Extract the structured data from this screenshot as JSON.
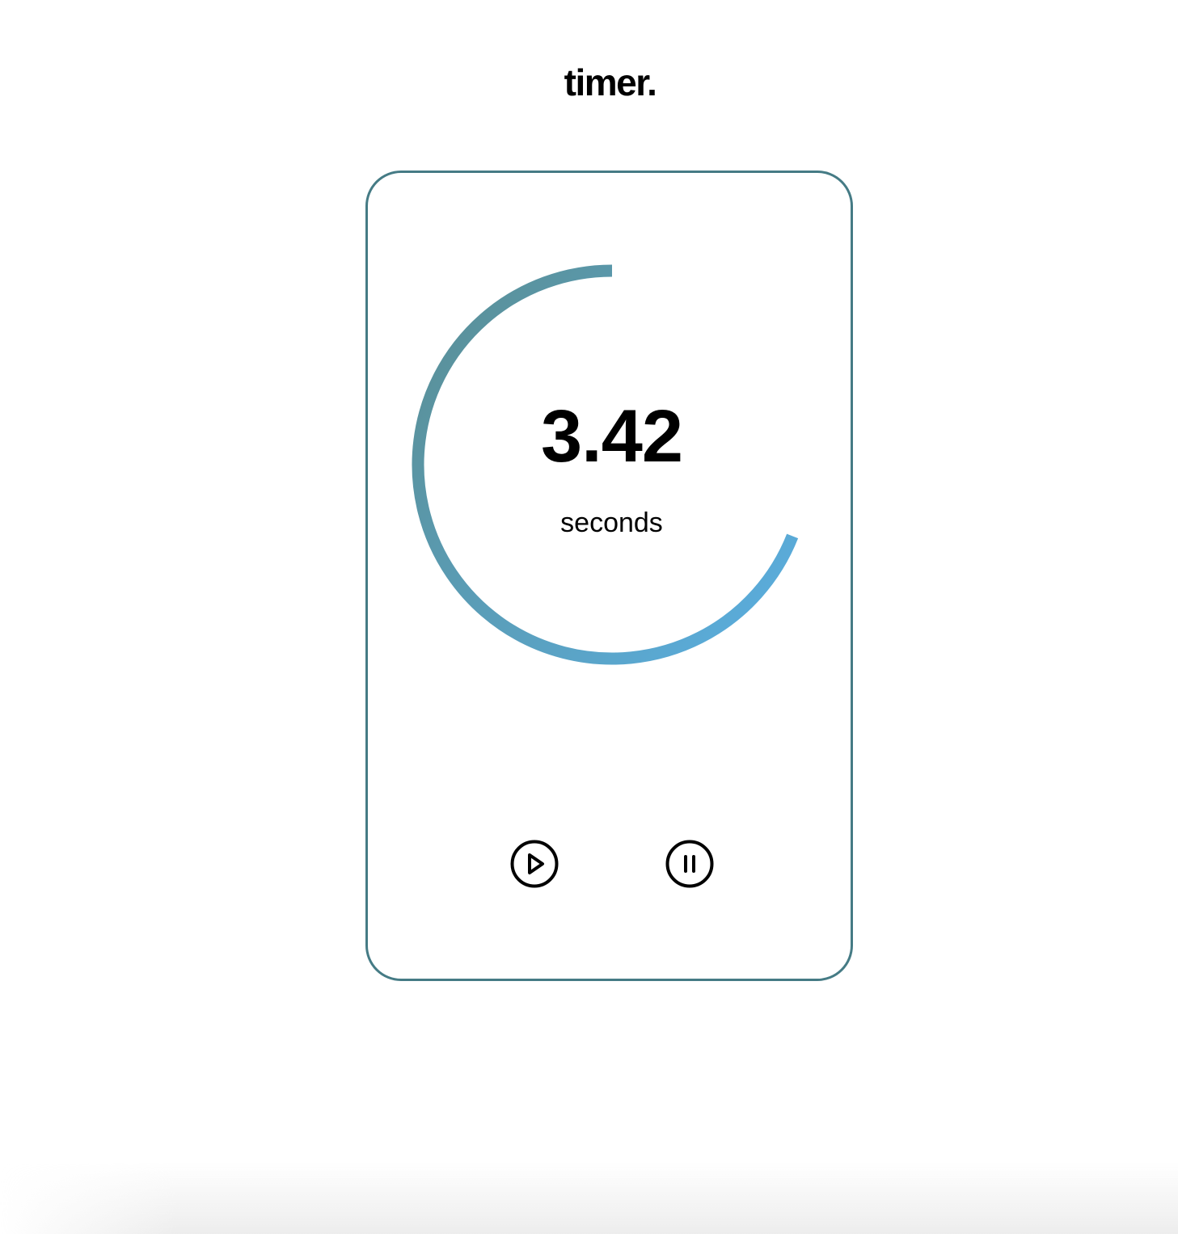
{
  "app": {
    "title": "timer."
  },
  "timer": {
    "value": "3.42",
    "unit": "seconds",
    "progress_fraction": 0.69
  },
  "controls": {
    "play_icon": "play-circle-icon",
    "pause_icon": "pause-circle-icon"
  },
  "colors": {
    "card_border": "#457b85",
    "ring_start": "#5a9098",
    "ring_end": "#5aaee0",
    "text": "#000000"
  }
}
